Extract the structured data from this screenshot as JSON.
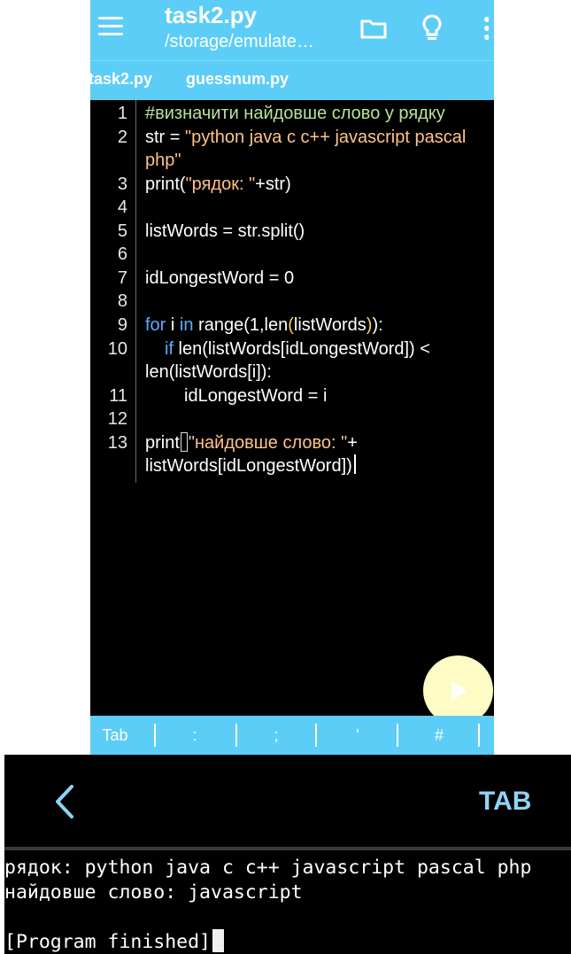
{
  "editor": {
    "title": "task2.py",
    "subtitle": "/storage/emulate…",
    "tabs": [
      {
        "label": "task2.py",
        "active": true
      },
      {
        "label": "guessnum.py",
        "active": false
      }
    ],
    "icons": [
      "menu-icon",
      "folder-icon",
      "lightbulb-icon",
      "more-vert-icon",
      "play-icon"
    ],
    "lines": [
      {
        "n": "1",
        "t": "#визначити найдовше слово у рядку"
      },
      {
        "n": "2",
        "a": "str = ",
        "b": "\"python java c c++ javascript pascal"
      },
      {
        "n": "",
        "t": "php\""
      },
      {
        "n": "3",
        "a": "print(",
        "b": "\"рядок: \"",
        "c": "+str)"
      },
      {
        "n": "4",
        "t": ""
      },
      {
        "n": "5",
        "t": "listWords = str.split()"
      },
      {
        "n": "6",
        "t": ""
      },
      {
        "n": "7",
        "t": "idLongestWord = 0"
      },
      {
        "n": "8",
        "t": ""
      },
      {
        "n": "9",
        "k1": "for",
        "m1": " i ",
        "k2": "in",
        "m2": " range(1,len",
        "p1": "(",
        "m3": "listWords",
        "p2": ")",
        "m4": "):"
      },
      {
        "n": "10",
        "k": "if",
        "t": " len(listWords[idLongestWord]) <"
      },
      {
        "n": "",
        "t": "len(listWords[i]):"
      },
      {
        "n": "11",
        "t": "idLongestWord = i"
      },
      {
        "n": "12",
        "t": ""
      },
      {
        "n": "13",
        "a": "print",
        "b": "\"найдовше слово: \"",
        "c": "+"
      },
      {
        "n": "",
        "t": "listWords[idLongestWord])"
      }
    ],
    "keybar": [
      "Tab",
      ":",
      ";",
      "'",
      "#"
    ]
  },
  "terminal": {
    "tab_button": "TAB",
    "output": [
      "рядок: python java c c++ javascript pascal php",
      "найдовше слово: javascript",
      "",
      "[Program finished]"
    ]
  },
  "colors": {
    "accent": "#5ccdf6",
    "comment": "#b6e39a",
    "string": "#ffc38a",
    "keyword": "#5aaeff",
    "run_button": "#fffbc4"
  }
}
